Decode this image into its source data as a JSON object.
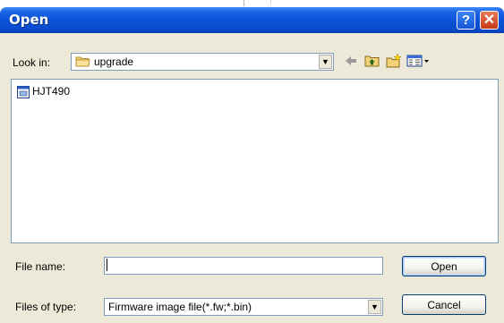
{
  "dialog": {
    "title": "Open",
    "help_glyph": "?",
    "close_glyph": "✕"
  },
  "look_in": {
    "label": "Look in:",
    "value": "upgrade",
    "icon": "folder-icon"
  },
  "toolbar": {
    "icons": [
      "back-arrow-icon",
      "up-folder-icon",
      "new-folder-icon",
      "view-menu-icon"
    ]
  },
  "file_list": {
    "items": [
      {
        "name": "HJT490",
        "icon": "file-icon"
      }
    ]
  },
  "file_name": {
    "label": "File name:",
    "value": ""
  },
  "files_of_type": {
    "label": "Files of type:",
    "value": "Firmware image file(*.fw;*.bin)"
  },
  "buttons": {
    "open": "Open",
    "cancel": "Cancel"
  },
  "colors": {
    "titlebar": "#0a53d8",
    "dialog_bg": "#ece9d8",
    "close": "#c43a16",
    "field_border": "#7f9db9"
  }
}
